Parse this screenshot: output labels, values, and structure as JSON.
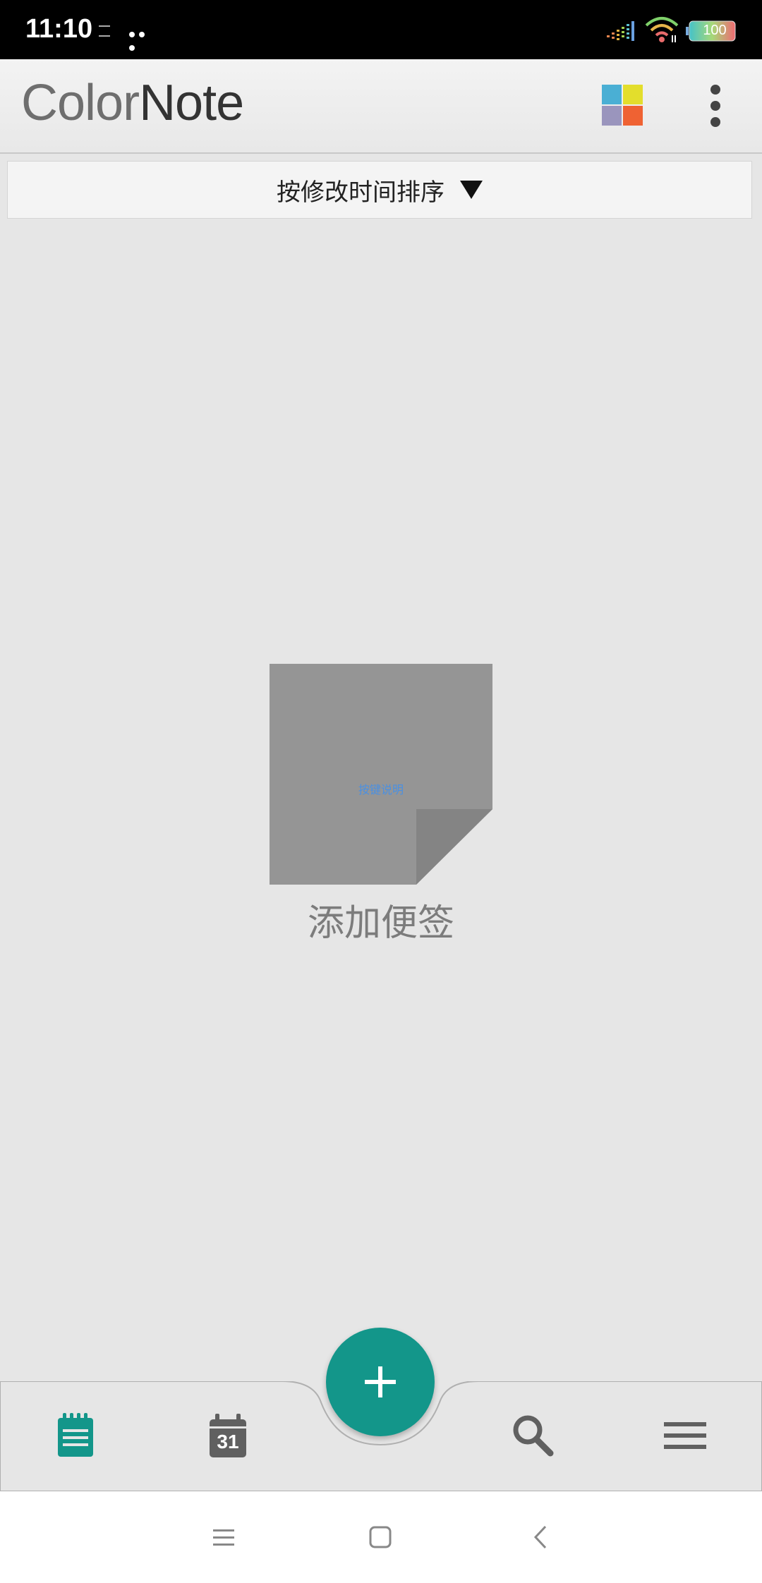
{
  "status_bar": {
    "time": "11:10",
    "battery": "100"
  },
  "header": {
    "logo_part1": "Color",
    "logo_part2": "Note",
    "palette_colors": [
      "#4aafd4",
      "#e3de2c",
      "#9a95bd",
      "#ef6233"
    ]
  },
  "sort": {
    "label": "按修改时间排序"
  },
  "empty_state": {
    "note_text": "按键说明",
    "label": "添加便签"
  },
  "bottom_nav": {
    "calendar_day": "31",
    "accent": "#13968a"
  }
}
